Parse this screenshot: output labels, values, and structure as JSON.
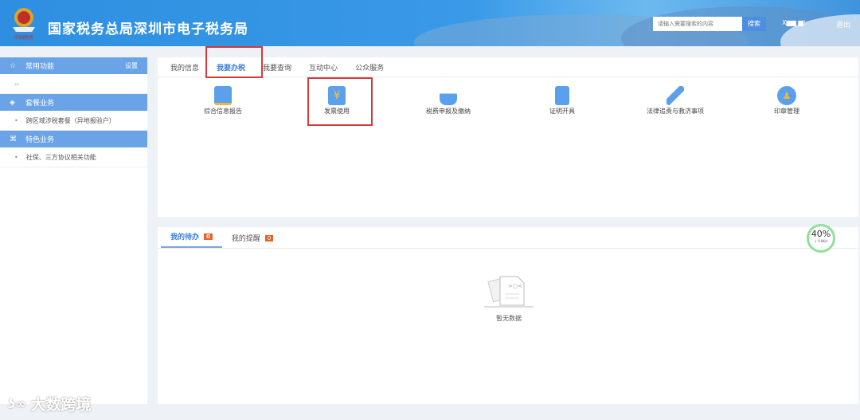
{
  "header": {
    "title": "国家税务总局深圳市电子税务局",
    "logo_text": "中国税务",
    "search_placeholder": "请输入需要搜索的内容",
    "search_button": "搜索",
    "user": "X▆▆ ▆!",
    "logout": "退出"
  },
  "sidebar": {
    "sections": [
      {
        "label": "常用功能",
        "icon": "star-icon",
        "action": "设置",
        "items": [
          "--"
        ]
      },
      {
        "label": "套餐业务",
        "icon": "layers-icon",
        "items": [
          "跨区域涉税套餐（异地报验户）"
        ]
      },
      {
        "label": "特色业务",
        "icon": "command-icon",
        "items": [
          "社保、三方协议相关功能"
        ]
      }
    ]
  },
  "main": {
    "tabs": [
      "我的信息",
      "我要办税",
      "我要查询",
      "互动中心",
      "公众服务"
    ],
    "active_tab": "我要办税",
    "functions": [
      {
        "label": "综合信息报告",
        "color": "#4a90e2"
      },
      {
        "label": "发票使用",
        "color": "#4a90e2"
      },
      {
        "label": "税费申报及缴纳",
        "color": "#4a90e2"
      },
      {
        "label": "证明开具",
        "color": "#4a90e2"
      },
      {
        "label": "法律追责与救济事项",
        "color": "#4a90e2"
      },
      {
        "label": "印章管理",
        "color": "#4a90e2"
      }
    ]
  },
  "tasks": {
    "tabs": [
      {
        "label": "我的待办",
        "count": "0"
      },
      {
        "label": "我的提醒",
        "count": "0"
      }
    ],
    "empty": "暂无数据"
  },
  "gauge": {
    "percent": "40%",
    "speed": "↓ 0.8K/s"
  },
  "watermark": "大数跨境"
}
